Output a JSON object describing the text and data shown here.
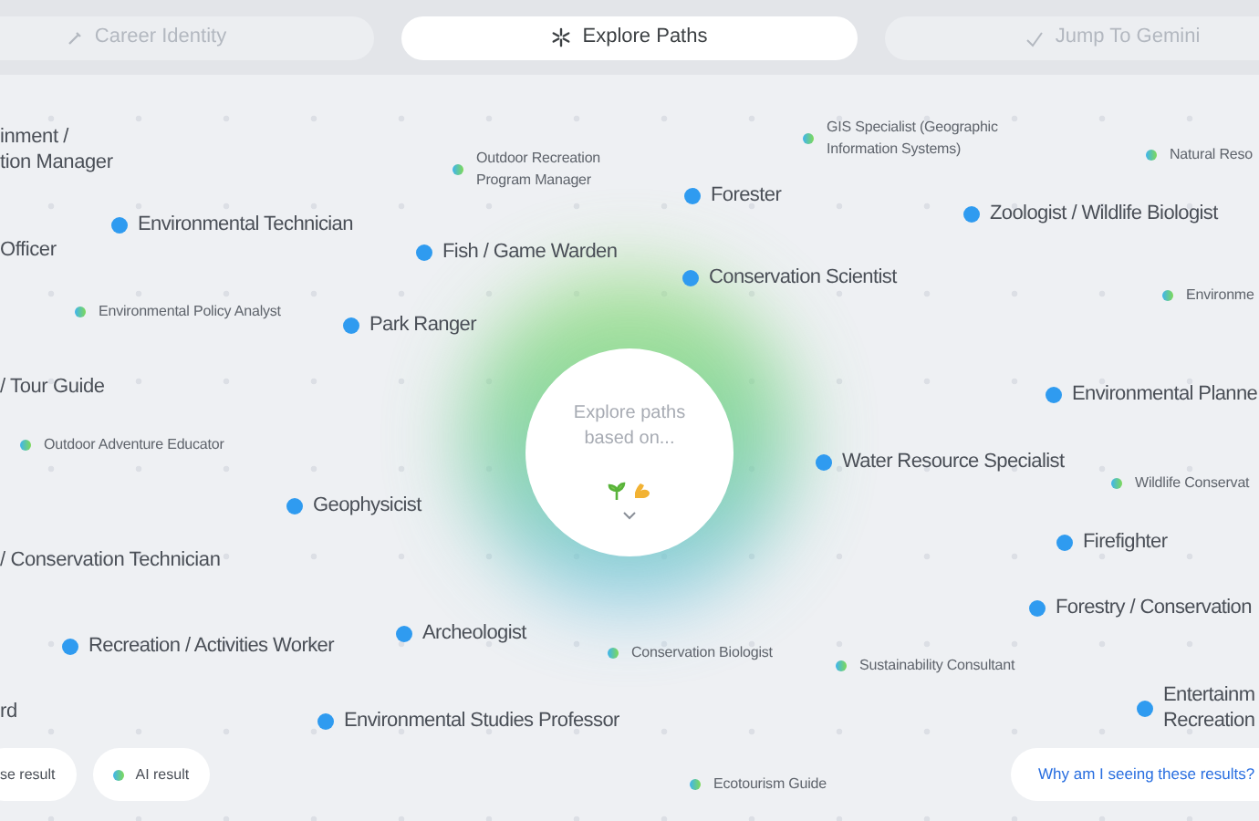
{
  "tabs": [
    {
      "label": "Career Identity",
      "selected": false
    },
    {
      "label": "Explore Paths",
      "selected": true
    },
    {
      "label": "Jump To Gemini",
      "selected": false
    }
  ],
  "paths": [
    {
      "kind": "cut",
      "text": "inment /\ntion Manager"
    },
    {
      "kind": "ai",
      "text": "Outdoor Recreation\nProgram Manager"
    },
    {
      "kind": "ai",
      "text": "GIS Specialist (Geographic\nInformation Systems)"
    },
    {
      "kind": "ai",
      "text": "Natural Reso"
    },
    {
      "kind": "database",
      "text": "Forester"
    },
    {
      "kind": "database",
      "text": "Zoologist / Wildlife Biologist"
    },
    {
      "kind": "database",
      "text": "Environmental Technician"
    },
    {
      "kind": "cut",
      "text": "Officer"
    },
    {
      "kind": "database",
      "text": "Fish / Game Warden"
    },
    {
      "kind": "database",
      "text": "Conservation Scientist"
    },
    {
      "kind": "ai",
      "text": "Environme"
    },
    {
      "kind": "ai",
      "text": "Environmental Policy Analyst"
    },
    {
      "kind": "database",
      "text": "Park Ranger"
    },
    {
      "kind": "cut",
      "text": "/ Tour Guide"
    },
    {
      "kind": "database",
      "text": "Environmental Planne"
    },
    {
      "kind": "ai",
      "text": "Outdoor Adventure Educator"
    },
    {
      "kind": "database",
      "text": "Water Resource Specialist"
    },
    {
      "kind": "ai",
      "text": "Wildlife Conservat"
    },
    {
      "kind": "database",
      "text": "Geophysicist"
    },
    {
      "kind": "database",
      "text": "Firefighter"
    },
    {
      "kind": "cut",
      "text": "/ Conservation Technician"
    },
    {
      "kind": "database",
      "text": "Forestry / Conservation"
    },
    {
      "kind": "database",
      "text": "Recreation / Activities Worker"
    },
    {
      "kind": "database",
      "text": "Archeologist"
    },
    {
      "kind": "ai",
      "text": "Conservation Biologist"
    },
    {
      "kind": "ai",
      "text": "Sustainability Consultant"
    },
    {
      "kind": "cut",
      "text": "rd"
    },
    {
      "kind": "database",
      "text": "Environmental Studies Professor"
    },
    {
      "kind": "database",
      "text": "Entertainm\nRecreation"
    },
    {
      "kind": "ai",
      "text": "Ecotourism Guide"
    }
  ],
  "center": {
    "text": "Explore paths\nbased on..."
  },
  "legend": [
    {
      "label": "se result"
    },
    {
      "kind": "ai",
      "label": "AI result"
    }
  ],
  "why_link": "Why am I seeing these results?"
}
